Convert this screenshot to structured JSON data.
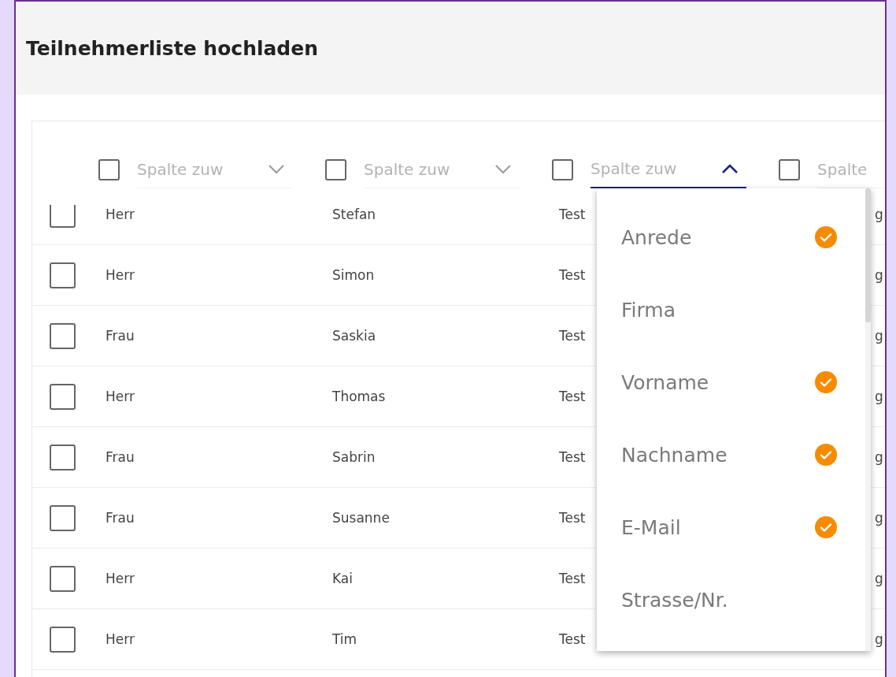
{
  "title": "Teilnehmerliste hochladen",
  "column_selectors": [
    {
      "placeholder": "Spalte zuw",
      "checked": false,
      "expanded": false
    },
    {
      "placeholder": "Spalte zuw",
      "checked": false,
      "expanded": false
    },
    {
      "placeholder": "Spalte zuw",
      "checked": false,
      "expanded": true
    },
    {
      "placeholder": "Spalte",
      "checked": false,
      "expanded": false
    }
  ],
  "rows": [
    {
      "checked": false,
      "cells": [
        "Herr",
        "Stefan",
        "Test",
        "g"
      ]
    },
    {
      "checked": false,
      "cells": [
        "Herr",
        "Simon",
        "Test",
        "g"
      ]
    },
    {
      "checked": false,
      "cells": [
        "Frau",
        "Saskia",
        "Test",
        "g"
      ]
    },
    {
      "checked": false,
      "cells": [
        "Herr",
        "Thomas",
        "Test",
        "g"
      ]
    },
    {
      "checked": false,
      "cells": [
        "Frau",
        "Sabrin",
        "Test",
        "g"
      ]
    },
    {
      "checked": false,
      "cells": [
        "Frau",
        "Susanne",
        "Test",
        "g"
      ]
    },
    {
      "checked": false,
      "cells": [
        "Herr",
        "Kai",
        "Test",
        "g"
      ]
    },
    {
      "checked": false,
      "cells": [
        "Herr",
        "Tim",
        "Test",
        "g"
      ]
    }
  ],
  "dropdown_options": [
    {
      "label": "Anrede",
      "selected": true
    },
    {
      "label": "Firma",
      "selected": false
    },
    {
      "label": "Vorname",
      "selected": true
    },
    {
      "label": "Nachname",
      "selected": true
    },
    {
      "label": "E-Mail",
      "selected": true
    },
    {
      "label": "Strasse/Nr.",
      "selected": false
    }
  ]
}
